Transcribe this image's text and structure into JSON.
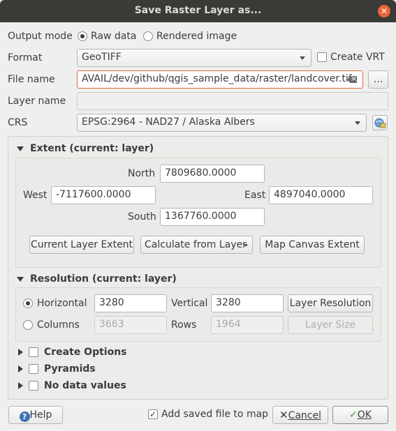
{
  "window": {
    "title": "Save Raster Layer as..."
  },
  "output_mode": {
    "label": "Output mode",
    "raw": "Raw data",
    "rendered": "Rendered image",
    "selected": "raw"
  },
  "format": {
    "label": "Format",
    "value": "GeoTIFF",
    "create_vrt": "Create VRT",
    "create_vrt_checked": false
  },
  "file_name": {
    "label": "File name",
    "value": "AVAIL/dev/github/qgis_sample_data/raster/landcover.tif",
    "browse": "..."
  },
  "layer_name": {
    "label": "Layer name",
    "value": ""
  },
  "crs": {
    "label": "CRS",
    "value": "EPSG:2964 - NAD27 / Alaska Albers"
  },
  "extent": {
    "title": "Extent (current: layer)",
    "north_label": "North",
    "north": "7809680.0000",
    "west_label": "West",
    "west": "-7117600.0000",
    "east_label": "East",
    "east": "4897040.0000",
    "south_label": "South",
    "south": "1367760.0000",
    "btn_current": "Current Layer Extent",
    "btn_calculate": "Calculate from Layer",
    "btn_canvas": "Map Canvas Extent"
  },
  "resolution": {
    "title": "Resolution (current: layer)",
    "horizontal_label": "Horizontal",
    "horizontal": "3280",
    "vertical_label": "Vertical",
    "vertical": "3280",
    "btn_layer_resolution": "Layer Resolution",
    "columns_label": "Columns",
    "columns": "3663",
    "rows_label": "Rows",
    "rows": "1964",
    "btn_layer_size": "Layer Size",
    "selected": "horizontal"
  },
  "sections": {
    "create_options": "Create Options",
    "pyramids": "Pyramids",
    "no_data": "No data values"
  },
  "footer": {
    "help": "Help",
    "add_saved": "Add saved file to map",
    "add_saved_checked": true,
    "cancel": "Cancel",
    "ok": "OK"
  }
}
